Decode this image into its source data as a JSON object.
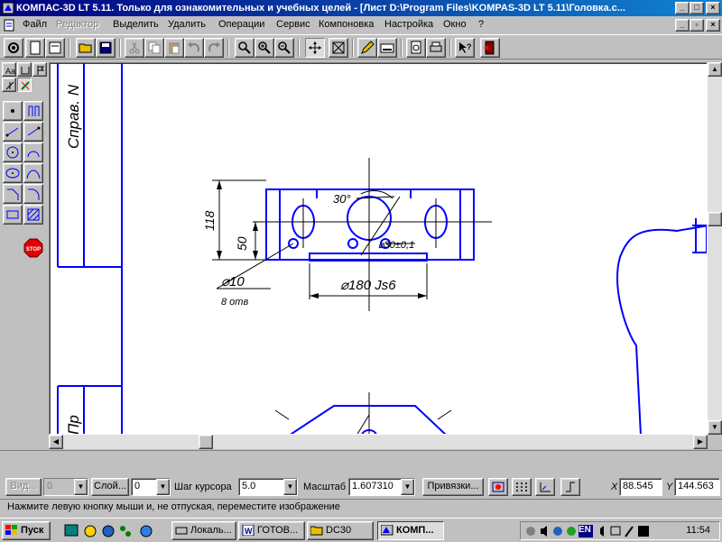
{
  "window": {
    "title": "КОМПАС-3D LT 5.11. Только для ознакомительных и учебных целей - [Лист D:\\Program Files\\KOMPAS-3D LT 5.11\\Головка.c..."
  },
  "menu": {
    "items": [
      "Файл",
      "Редактор",
      "Выделить",
      "Удалить",
      "Операции",
      "Сервис",
      "Компоновка",
      "Настройка",
      "Окно",
      "?"
    ]
  },
  "drawing": {
    "dim_118": "118",
    "dim_50": "50",
    "dim_angle": "30°",
    "dim_hole_d": "⌀10",
    "dim_hole_count": "8 отв",
    "dim_bore": "⌀30±0,1",
    "dim_outer": "⌀180 Js6",
    "stamp_top": "Справ. N",
    "stamp_bottom": "Пр"
  },
  "params": {
    "view_label": "Вид...",
    "view_value": "0",
    "layer_label": "Слой...",
    "layer_value": "0",
    "cursor_step_label": "Шаг курсора",
    "cursor_step_value": "5.0",
    "scale_label": "Масштаб",
    "scale_value": "1.607310",
    "snaps_label": "Привязки...",
    "x_label": "X",
    "x_value": "88.545",
    "y_label": "Y",
    "y_value": "144.563"
  },
  "status": {
    "message": "Нажмите левую кнопку мыши и, не отпуская, переместите изображение"
  },
  "taskbar": {
    "start_label": "Пуск",
    "tasks": [
      "Локаль...",
      "ГОТОВ...",
      "DC30",
      "КОМП..."
    ],
    "lang": "EN",
    "clock": "11:54"
  },
  "colors": {
    "titlebar": "#000080",
    "drawing_line": "#0000ff",
    "stop_button": "#e00000"
  }
}
